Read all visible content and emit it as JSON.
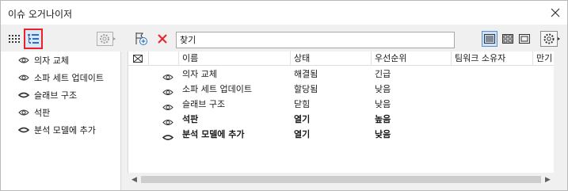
{
  "window": {
    "title": "이슈 오거나이저"
  },
  "left": {
    "items": [
      {
        "label": "의자 교체",
        "icon": "eye-icon"
      },
      {
        "label": "소파 세트 업데이트",
        "icon": "eye-icon"
      },
      {
        "label": "슬래브 구조",
        "icon": "eye-closed-icon"
      },
      {
        "label": "석판",
        "icon": "eye-icon"
      },
      {
        "label": "분석 모델에 추가",
        "icon": "eye-closed-icon"
      }
    ]
  },
  "search": {
    "value": "찾기"
  },
  "table": {
    "columns": [
      "이름",
      "상태",
      "우선순위",
      "팀워크 소유자",
      "만기"
    ],
    "rows": [
      {
        "name": "의자 교체",
        "status": "해결됨",
        "priority": "긴급",
        "icon": "eye-icon",
        "bold": false
      },
      {
        "name": "소파 세트 업데이트",
        "status": "할당됨",
        "priority": "낮음",
        "icon": "eye-icon",
        "bold": false
      },
      {
        "name": "슬래브 구조",
        "status": "닫힘",
        "priority": "낮음",
        "icon": "eye-icon",
        "bold": false
      },
      {
        "name": "석판",
        "status": "열기",
        "priority": "높음",
        "icon": "eye-icon",
        "bold": true
      },
      {
        "name": "분석 모델에 추가",
        "status": "열기",
        "priority": "낮음",
        "icon": "eye-closed-icon",
        "bold": true
      }
    ]
  },
  "colors": {
    "selected_border": "#e8232c",
    "delete_icon": "#e8232c",
    "accent": "#2d6fbf"
  }
}
